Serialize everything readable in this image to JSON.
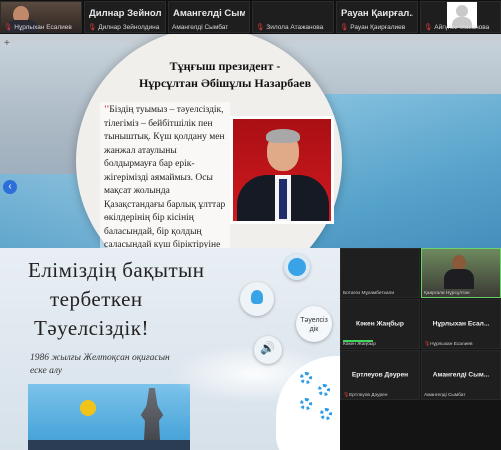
{
  "top_gallery": {
    "tiles": [
      {
        "big": "",
        "small": "Нұрлыхан Есалиев",
        "has_video": true
      },
      {
        "big": "Дилнар Зейнол...",
        "small": "Дилнар Зейнолдина",
        "has_video": false
      },
      {
        "big": "Амангелді Сым...",
        "small": "Амангелді Сымбат",
        "has_video": false
      },
      {
        "big": "",
        "small": "Зилола Атажанова",
        "has_video": false
      },
      {
        "big": "Рауан Қаирғал...",
        "small": "Рауан Қаирғалиев",
        "has_video": false
      },
      {
        "big": "",
        "small": "Айгүлім Маканова",
        "has_avatar": true
      }
    ]
  },
  "slide1": {
    "title_line1": "Тұңғыш президент -",
    "title_line2": "Нұрсұлтан Әбішұлы Назарбаев",
    "quote_open": "''",
    "quote_text": "Біздің туымыз – тәуелсіздік, тілегіміз – бейбітшілік пен тыныштық. Күш қолдану мен жанжал атаулыны болдырмауға бар ерік-жігерімізді аямаймыз. Осы мақсат жолында Қазақстандағы барлық ұлттар өкілдерінің бір кісінің баласындай, бір қолдың саласындай күш біріктіруіне мүделіміз",
    "quote_close": "''",
    "nav_prev": "‹",
    "add_symbol": "+"
  },
  "slide2": {
    "header_line1": "Еліміздің бақытын",
    "header_line2": "тербеткен",
    "header_line3": "Тәуелсіздік!",
    "subtitle": "1986 жылғы Желтоқсан оқиғасын еске алу",
    "circle_text": "Тәуелсіз дік"
  },
  "bottom_grid": {
    "cells": [
      {
        "name": "",
        "small": "Ботагөз Мұхамбетхали",
        "camera": false
      },
      {
        "name": "",
        "small": "Қаиргали Нұрсұлтан",
        "camera": true,
        "active": true
      },
      {
        "name": "Кәкен Жаңбыр",
        "small": "Кәкен Жаңбыр",
        "camera": false
      },
      {
        "name": "Нұрлыхан Есал...",
        "small": "Нұрлыхан Есалиев",
        "camera": false
      },
      {
        "name": "Ертлеуов Дәурен",
        "small": "Ертлеуов Дәурен",
        "camera": false
      },
      {
        "name": "Амангелді Сым...",
        "small": "Амангелді Сымбат",
        "camera": false
      }
    ]
  },
  "colors": {
    "zoom_dark": "#1e1e1e",
    "mic_muted": "#e03b3b",
    "speaking_green": "#3fd45a",
    "slide_blue": "#3aa3e8",
    "quote_mark": "#c04040"
  }
}
